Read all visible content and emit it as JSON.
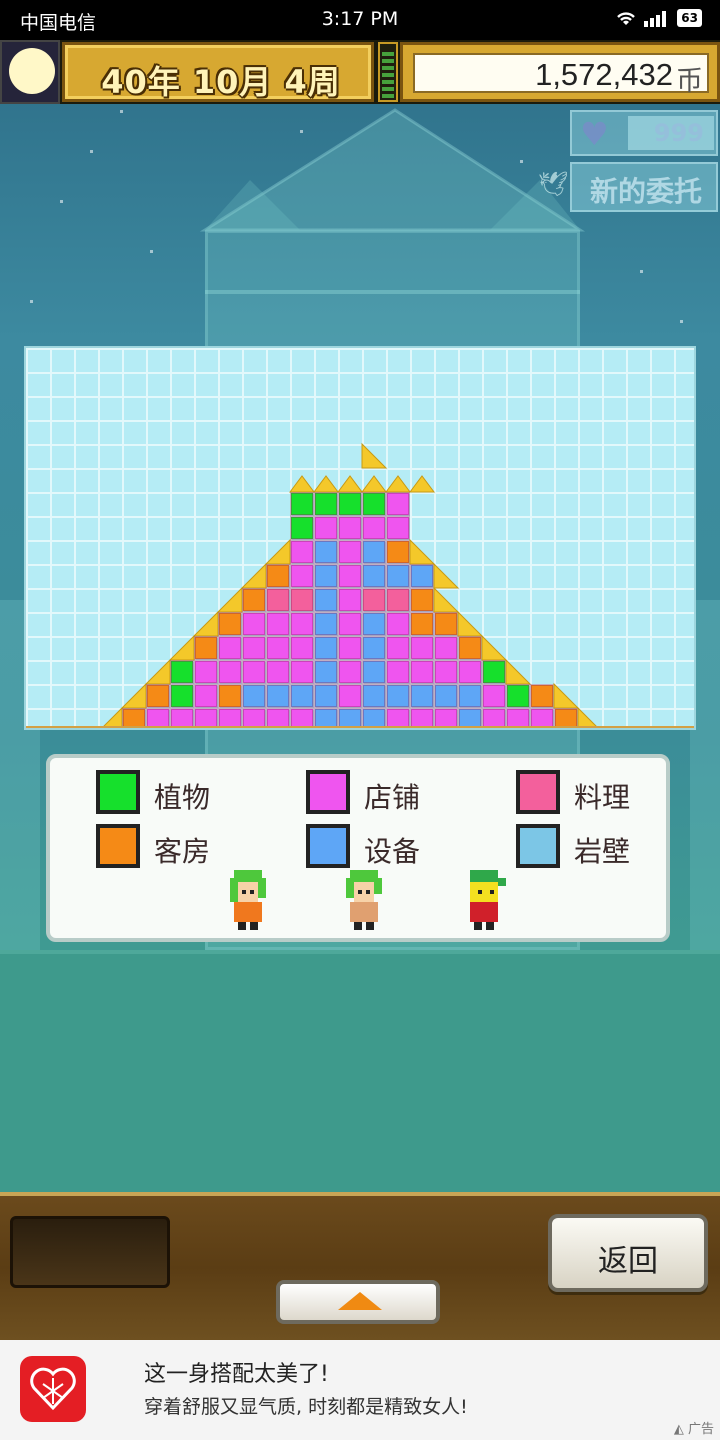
{
  "status_bar": {
    "carrier": "中国电信",
    "time": "3:17 PM",
    "battery": "63"
  },
  "hud": {
    "date": "40年 10月 4周",
    "money": "1,572,432",
    "money_unit": "币",
    "hearts": "999",
    "request_label": "新的委托"
  },
  "chart_data": {
    "type": "heatmap",
    "cols": 28,
    "rows": 16,
    "key": {
      "G": "植物",
      "M": "店铺",
      "P": "料理",
      "O": "客房",
      "B": "设备",
      "L": "岩壁",
      "Y": "roof (sand)",
      ".": "empty"
    },
    "colors": {
      "G": "#16e02c",
      "M": "#ef55ef",
      "P": "#f3609c",
      "O": "#f58a16",
      "B": "#5ea6f6",
      "L": "#7cc6e6",
      "Y": "#f4c82a",
      "BASE": "#d2a045"
    },
    "cells": [
      "............................",
      "............................",
      "............................",
      "............................",
      "..............Y.............",
      "...........YYYYYY...........",
      "...........GGGGM............",
      "...........GMMMM............",
      "..........YMBMBOY............",
      ".........YOMBMBBBY...........",
      "........YOPPBMPPOY...........",
      ".......YOMMMBMBMOOY..........",
      "......YOMMMMBMBMMMOY.........",
      ".....YGMMMMMBMBMMMMGY........",
      "....YOGMOBBBBMBBBBBMGOY......",
      "...YOMMMMMMMBBBMMMBMMMOY....."
    ],
    "has_base_bar": true
  },
  "legend": {
    "items": [
      {
        "label": "植物",
        "color": "#16e02c"
      },
      {
        "label": "店铺",
        "color": "#ef55ef"
      },
      {
        "label": "料理",
        "color": "#f3609c"
      },
      {
        "label": "客房",
        "color": "#f58a16"
      },
      {
        "label": "设备",
        "color": "#5ea6f6"
      },
      {
        "label": "岩壁",
        "color": "#7cc6e6"
      }
    ]
  },
  "controls": {
    "back_label": "返回"
  },
  "ad": {
    "title": "这一身搭配太美了!",
    "subtitle": "穿着舒服又显气质, 时刻都是精致女人!",
    "tag": "广告"
  }
}
